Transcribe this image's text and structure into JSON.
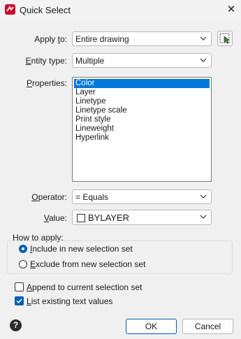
{
  "window": {
    "title": "Quick Select",
    "close_glyph": "✕"
  },
  "apply_to": {
    "label_pre": "Apply ",
    "label_key": "t",
    "label_post": "o:",
    "value": "Entire drawing"
  },
  "entity_type": {
    "label_key": "E",
    "label_post": "ntity type:",
    "value": "Multiple"
  },
  "properties": {
    "label_key": "P",
    "label_post": "roperties:",
    "items": [
      "Color",
      "Layer",
      "Linetype",
      "Linetype scale",
      "Print style",
      "Lineweight",
      "Hyperlink"
    ],
    "selected_index": 0
  },
  "operator": {
    "label_key": "O",
    "label_post": "perator:",
    "value": "= Equals"
  },
  "value_field": {
    "label_key": "V",
    "label_post": "alue:",
    "value": "BYLAYER"
  },
  "how_to_apply": {
    "legend": "How to apply:",
    "include": {
      "label_key": "I",
      "label_post": "nclude in new selection set",
      "checked": true
    },
    "exclude": {
      "label_key": "E",
      "label_post": "xclude from new selection set",
      "checked": false
    }
  },
  "append": {
    "label_key": "A",
    "label_post": "ppend to current selection set",
    "checked": false
  },
  "list_existing": {
    "label_key": "L",
    "label_post": "ist existing text values",
    "checked": true
  },
  "buttons": {
    "ok": "OK",
    "cancel": "Cancel"
  },
  "colors": {
    "accent": "#005fb8",
    "selection": "#0078d7",
    "brand": "#c8102e"
  },
  "icons": {
    "app": "app-logo-icon",
    "help": "help-icon",
    "select_objects": "select-objects-icon"
  }
}
